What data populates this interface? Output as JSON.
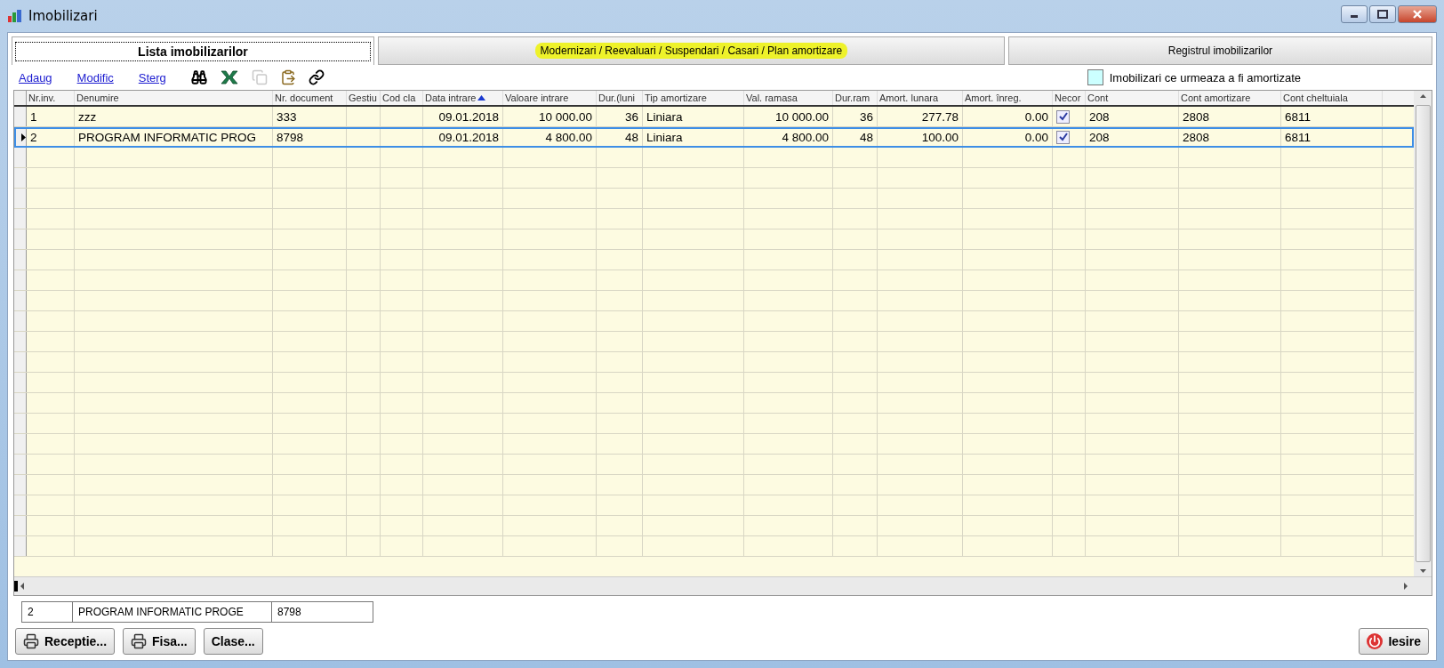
{
  "window": {
    "title": "Imobilizari"
  },
  "tabs": [
    {
      "label": "Lista imobilizarilor",
      "selected": true,
      "highlighted": false
    },
    {
      "label": "Modernizari / Reevaluari / Suspendari / Casari / Plan amortizare",
      "selected": false,
      "highlighted": true
    },
    {
      "label": "Registrul imobilizarilor",
      "selected": false,
      "highlighted": false
    }
  ],
  "toolbar": {
    "links": [
      "Adaug",
      "Modific",
      "Sterg"
    ],
    "icons": [
      {
        "kind": "binoculars",
        "disabled": false
      },
      {
        "kind": "excel",
        "disabled": false
      },
      {
        "kind": "copy",
        "disabled": true
      },
      {
        "kind": "paste",
        "disabled": false
      },
      {
        "kind": "link",
        "disabled": false
      }
    ]
  },
  "legend": {
    "label": "Imobilizari ce urmeaza a fi amortizate",
    "color": "#ccffff"
  },
  "table": {
    "columns": [
      {
        "label": "Nr.inv.",
        "kind": "text"
      },
      {
        "label": "Denumire",
        "kind": "text"
      },
      {
        "label": "Nr. document",
        "kind": "text"
      },
      {
        "label": "Gestiu",
        "kind": "text"
      },
      {
        "label": "Cod cla",
        "kind": "text"
      },
      {
        "label": "Data intrare",
        "kind": "number",
        "sorted": true
      },
      {
        "label": "Valoare intrare",
        "kind": "number"
      },
      {
        "label": "Dur.(luni",
        "kind": "number"
      },
      {
        "label": "Tip amortizare",
        "kind": "text"
      },
      {
        "label": "Val. ramasa",
        "kind": "number"
      },
      {
        "label": "Dur.ram",
        "kind": "number"
      },
      {
        "label": "Amort. lunara",
        "kind": "number"
      },
      {
        "label": "Amort. înreg.",
        "kind": "number"
      },
      {
        "label": "Necor",
        "kind": "checkbox"
      },
      {
        "label": "Cont",
        "kind": "text"
      },
      {
        "label": "Cont amortizare",
        "kind": "text"
      },
      {
        "label": "Cont cheltuiala",
        "kind": "text"
      }
    ],
    "rows": [
      {
        "current": false,
        "cells": [
          "1",
          "zzz",
          "333",
          "",
          "",
          "09.01.2018",
          "10 000.00",
          "36",
          "Liniara",
          "10 000.00",
          "36",
          "277.78",
          "0.00",
          true,
          "208",
          "2808",
          "6811"
        ]
      },
      {
        "current": true,
        "cells": [
          "2",
          "PROGRAM INFORMATIC PROG",
          "8798",
          "",
          "",
          "09.01.2018",
          "4 800.00",
          "48",
          "Liniara",
          "4 800.00",
          "48",
          "100.00",
          "0.00",
          true,
          "208",
          "2808",
          "6811"
        ]
      }
    ]
  },
  "summary": [
    "2",
    "PROGRAM INFORMATIC PROGE",
    "8798"
  ],
  "buttons": [
    {
      "label": "Receptie...",
      "kind": "print"
    },
    {
      "label": "Fisa...",
      "kind": "print"
    },
    {
      "label": "Clase...",
      "kind": "plain"
    }
  ],
  "exit_button": {
    "label": "Iesire"
  }
}
